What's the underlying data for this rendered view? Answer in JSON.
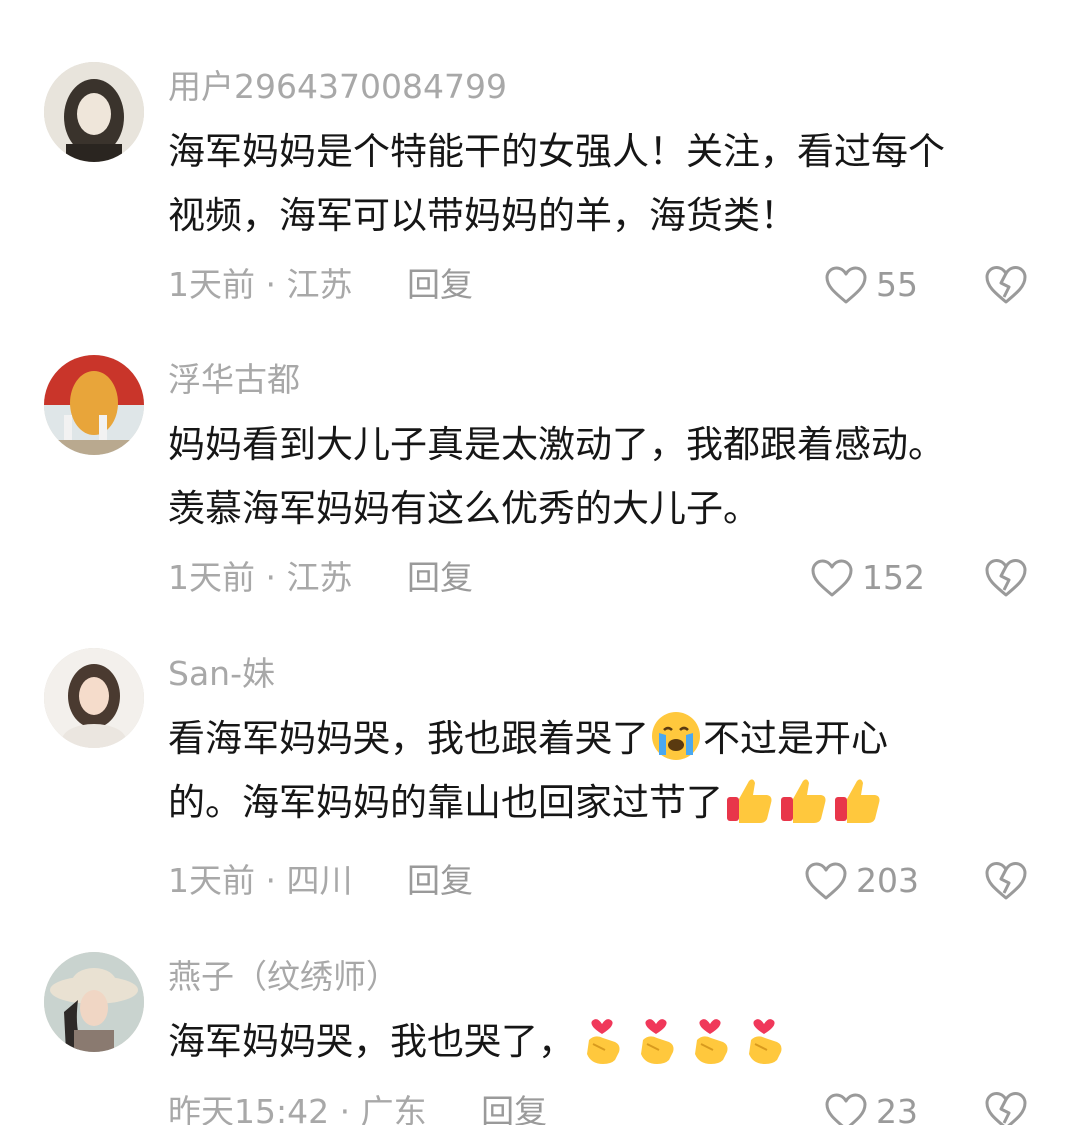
{
  "comments": [
    {
      "username": "用户2964370084799",
      "lines": [
        "海军妈妈是个特能干的女强人！关注，看过每个",
        "视频，海军可以带妈妈的羊，海货类！"
      ],
      "time": "1天前",
      "location": "江苏",
      "reply_label": "回复",
      "likes": "55"
    },
    {
      "username": "浮华古都",
      "lines": [
        "妈妈看到大儿子真是太激动了，我都跟着感动。",
        "羡慕海军妈妈有这么优秀的大儿子。"
      ],
      "time": "1天前",
      "location": "江苏",
      "reply_label": "回复",
      "likes": "152"
    },
    {
      "username": "San-妹",
      "line1_a": "看海军妈妈哭，我也跟着哭了",
      "line1_b": "不过是开心",
      "line2": "的。海军妈妈的靠山也回家过节了",
      "emojis": [
        "crying-face",
        "thumbs-up",
        "thumbs-up",
        "thumbs-up"
      ],
      "time": "1天前",
      "location": "四川",
      "reply_label": "回复",
      "likes": "203"
    },
    {
      "username": "燕子（纹绣师）",
      "line1": "海军妈妈哭，我也哭了，",
      "emojis": [
        "finger-heart",
        "finger-heart",
        "finger-heart",
        "finger-heart"
      ],
      "time": "昨天15:42",
      "location": "广东",
      "reply_label": "回复",
      "likes": "23"
    }
  ],
  "separator": "·",
  "colors": {
    "secondary_text": "#a8a8a8",
    "primary_text": "#161616",
    "emoji_yellow": "#ffc83d"
  }
}
